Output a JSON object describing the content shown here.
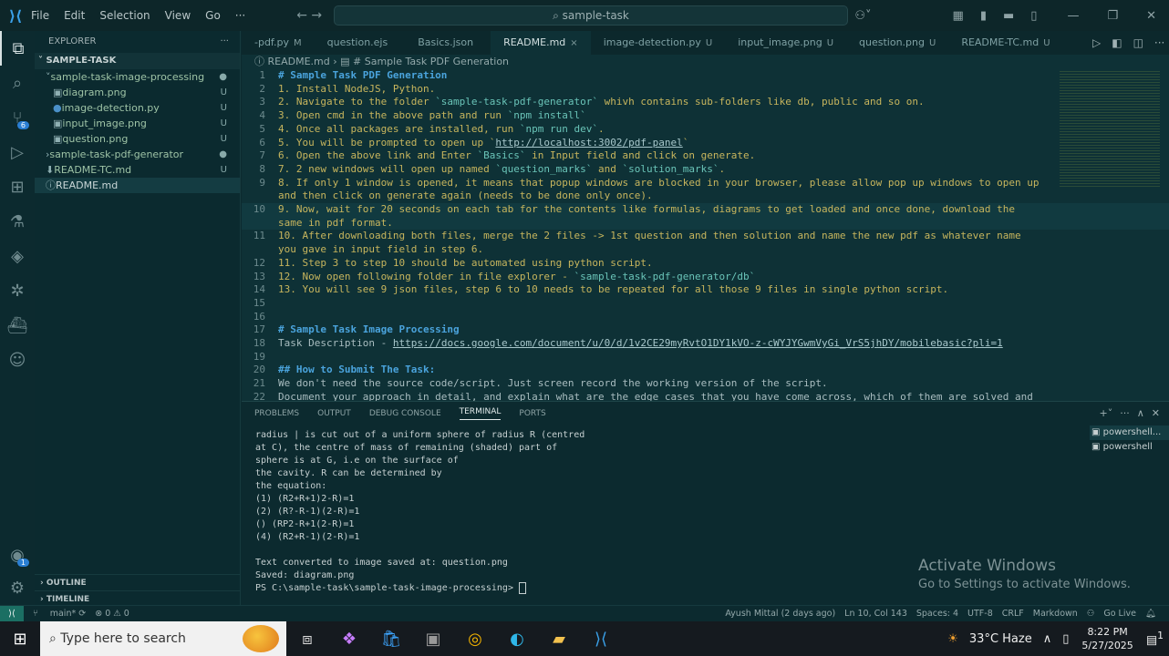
{
  "titlebar": {
    "menu": [
      "File",
      "Edit",
      "Selection",
      "View",
      "Go",
      "···"
    ],
    "search": "sample-task"
  },
  "colors": {
    "accent": "#3aa0e8",
    "heading": "#4aa3dc",
    "text": "#c7b55d",
    "inline_code": "#6ac4b8",
    "remote": "#1b6f63"
  },
  "activity_bar": {
    "items": [
      {
        "icon": "files-icon"
      },
      {
        "icon": "search-icon"
      },
      {
        "icon": "source-control-icon",
        "badge": "6"
      },
      {
        "icon": "run-debug-icon"
      },
      {
        "icon": "extensions-icon"
      },
      {
        "icon": "testing-icon"
      },
      {
        "icon": "python-icon"
      },
      {
        "icon": "remote-explorer-icon"
      },
      {
        "icon": "docker-icon"
      },
      {
        "icon": "copilot-icon"
      }
    ],
    "bottom": [
      {
        "icon": "account-icon",
        "badge": "1"
      },
      {
        "icon": "settings-gear-icon"
      }
    ]
  },
  "explorer": {
    "title": "EXPLORER",
    "more": "···",
    "root": "SAMPLE-TASK",
    "items": [
      {
        "label": "sample-task-image-processing",
        "type": "folder-open",
        "status": "●",
        "depth": 1
      },
      {
        "label": "diagram.png",
        "type": "image",
        "status": "U",
        "depth": 2
      },
      {
        "label": "image-detection.py",
        "type": "python",
        "status": "U",
        "depth": 2
      },
      {
        "label": "input_image.png",
        "type": "image",
        "status": "U",
        "depth": 2
      },
      {
        "label": "question.png",
        "type": "image",
        "status": "U",
        "depth": 2
      },
      {
        "label": "sample-task-pdf-generator",
        "type": "folder",
        "status": "●",
        "depth": 1
      },
      {
        "label": "README-TC.md",
        "type": "markdown",
        "status": "U",
        "depth": 1
      },
      {
        "label": "README.md",
        "type": "info",
        "status": "",
        "depth": 1,
        "selected": true
      }
    ],
    "outline": "OUTLINE",
    "timeline": "TIMELINE"
  },
  "tabs": [
    {
      "label": "-pdf.py",
      "status": "M"
    },
    {
      "label": "question.ejs",
      "status": ""
    },
    {
      "label": "Basics.json",
      "status": ""
    },
    {
      "label": "README.md",
      "status": "×",
      "active": true
    },
    {
      "label": "image-detection.py",
      "status": "U"
    },
    {
      "label": "input_image.png",
      "status": "U"
    },
    {
      "label": "question.png",
      "status": "U"
    },
    {
      "label": "README-TC.md",
      "status": "U"
    }
  ],
  "breadcrumb": [
    "README.md",
    "# Sample Task PDF Generation"
  ],
  "editor_lines": [
    {
      "n": "1",
      "segs": [
        {
          "t": "# Sample Task PDF Generation",
          "c": "heading"
        }
      ]
    },
    {
      "n": "2",
      "segs": [
        {
          "t": "1. Install NodeJS, Python."
        }
      ]
    },
    {
      "n": "3",
      "segs": [
        {
          "t": "2. Navigate to the folder "
        },
        {
          "t": "`sample-task-pdf-generator`",
          "c": "code"
        },
        {
          "t": " whivh contains sub-folders like db, public and so on."
        }
      ]
    },
    {
      "n": "4",
      "segs": [
        {
          "t": "3. Open cmd in the above path and run "
        },
        {
          "t": "`npm install`",
          "c": "code"
        }
      ]
    },
    {
      "n": "5",
      "segs": [
        {
          "t": "4. Once all packages are installed, run "
        },
        {
          "t": "`npm run dev`",
          "c": "code"
        },
        {
          "t": "."
        }
      ]
    },
    {
      "n": "6",
      "segs": [
        {
          "t": "5. You will be prompted to open up "
        },
        {
          "t": "`"
        },
        {
          "t": "http://localhost:3002/pdf-panel",
          "c": "link"
        },
        {
          "t": "`"
        }
      ]
    },
    {
      "n": "7",
      "segs": [
        {
          "t": "6. Open the above link and Enter "
        },
        {
          "t": "`Basics`",
          "c": "code"
        },
        {
          "t": " in Input field and click on generate."
        }
      ]
    },
    {
      "n": "8",
      "segs": [
        {
          "t": "7. 2 new windows will open up named "
        },
        {
          "t": "`question_marks`",
          "c": "code"
        },
        {
          "t": " and "
        },
        {
          "t": "`solution_marks`",
          "c": "code"
        },
        {
          "t": "."
        }
      ]
    },
    {
      "n": "9",
      "segs": [
        {
          "t": "8. If only 1 window is opened, it means that popup windows are blocked in your browser, please allow pop up windows to open up and then click on generate again (needs to be done only once)."
        }
      ]
    },
    {
      "n": "10",
      "cur": true,
      "segs": [
        {
          "t": "9. Now, wait for 20 seconds on each tab for the contents like formulas, diagrams to get loaded and once done, download the same in pdf format."
        }
      ]
    },
    {
      "n": "11",
      "segs": [
        {
          "t": "10. After downloading both files, merge the 2 files -> 1st question and then solution and name the new pdf as whatever name you gave in input field in step 6."
        }
      ]
    },
    {
      "n": "12",
      "segs": [
        {
          "t": "11. Step 3 to step 10 should be automated using python script."
        }
      ]
    },
    {
      "n": "13",
      "segs": [
        {
          "t": "12. Now open following folder in file explorer - "
        },
        {
          "t": "`sample-task-pdf-generator/db`",
          "c": "code"
        }
      ]
    },
    {
      "n": "14",
      "segs": [
        {
          "t": "13. You will see 9 json files, step 6 to 10 needs to be repeated for all those 9 files in single python script."
        }
      ]
    },
    {
      "n": "15",
      "segs": []
    },
    {
      "n": "16",
      "segs": []
    },
    {
      "n": "17",
      "segs": [
        {
          "t": "# Sample Task Image Processing",
          "c": "heading"
        }
      ]
    },
    {
      "n": "18",
      "segs": [
        {
          "t": "Task Description - ",
          "c": "plain"
        },
        {
          "t": "https://docs.google.com/document/u/0/d/1v2CE29myRvtO1DY1kVO-z-cWYJYGwmVyGi_VrS5jhDY/mobilebasic?pli=1",
          "c": "link"
        }
      ]
    },
    {
      "n": "19",
      "segs": []
    },
    {
      "n": "20",
      "segs": [
        {
          "t": "## How to Submit The Task:",
          "c": "heading"
        }
      ]
    },
    {
      "n": "21",
      "segs": [
        {
          "t": "We don't need the source code/script. Just screen record the working version of the script.",
          "c": "plain"
        }
      ]
    },
    {
      "n": "22",
      "segs": [
        {
          "t": "Document your approach in detail, and explain what are the edge cases that you have come across, which of them are solved and",
          "c": "plain"
        }
      ]
    }
  ],
  "panel": {
    "tabs": [
      "PROBLEMS",
      "OUTPUT",
      "DEBUG CONSOLE",
      "TERMINAL",
      "PORTS"
    ],
    "active": "TERMINAL",
    "terminal_output": "radius | is cut out of a uniform sphere of radius R (centred\nat C), the centre of mass of remaining (shaded) part of\nsphere is at G, i.e on the surface of\nthe cavity. R can be determined by\nthe equation:\n(1) (R2+R+1)2-R)=1\n(2) (R?-R-1)(2-R)=1\n() (RP2-R+1(2-R)=1\n(4) (R2+R-1)(2-R)=1\n\nText converted to image saved at: question.png\nSaved: diagram.png",
    "prompt": "PS C:\\sample-task\\sample-task-image-processing> ",
    "terminals": [
      "powershell...",
      "powershell"
    ]
  },
  "watermark": {
    "title": "Activate Windows",
    "subtitle": "Go to Settings to activate Windows."
  },
  "statusbar": {
    "branch": "main*",
    "problems": "⊗ 0 ⚠ 0",
    "blame": "Ayush Mittal (2 days ago)",
    "position": "Ln 10, Col 143",
    "spaces": "Spaces: 4",
    "encoding": "UTF-8",
    "eol": "CRLF",
    "language": "Markdown",
    "golive": "Go Live"
  },
  "taskbar": {
    "search_placeholder": "Type here to search",
    "weather": "33°C  Haze",
    "time": "8:22 PM",
    "date": "5/27/2025",
    "notifications": "1"
  }
}
